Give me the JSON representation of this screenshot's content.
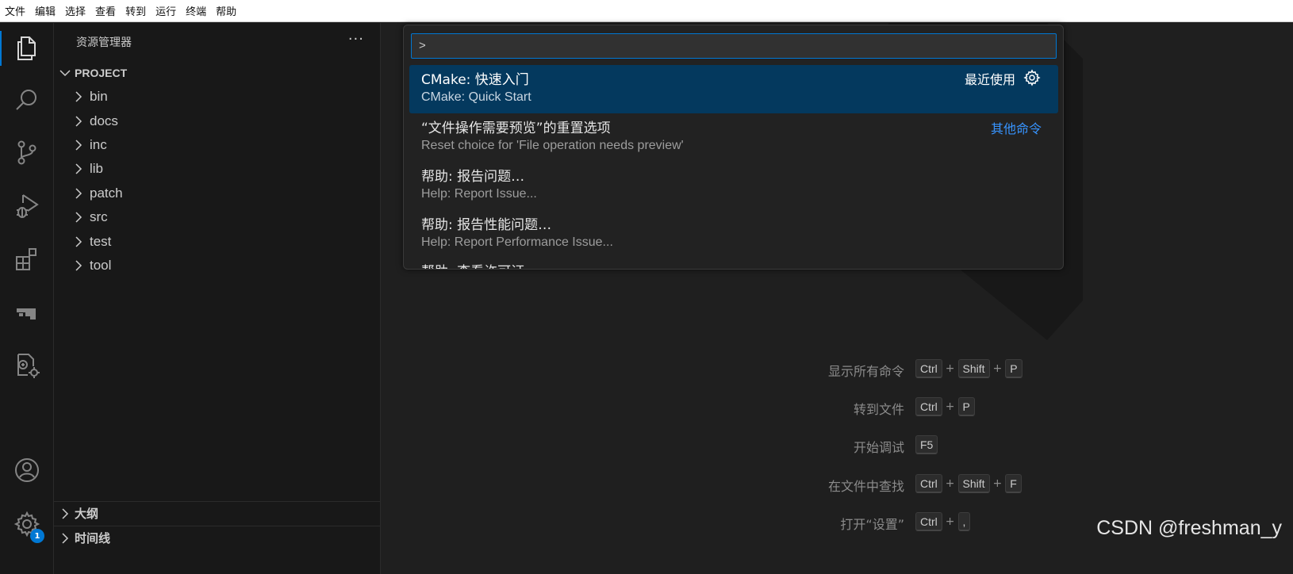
{
  "menubar": {
    "items": [
      "文件",
      "编辑",
      "选择",
      "查看",
      "转到",
      "运行",
      "终端",
      "帮助"
    ]
  },
  "activity_bar": {
    "items": [
      {
        "icon": "files-icon",
        "active": true
      },
      {
        "icon": "search-icon",
        "active": false
      },
      {
        "icon": "source-control-icon",
        "active": false
      },
      {
        "icon": "run-debug-icon",
        "active": false
      },
      {
        "icon": "extensions-icon",
        "active": false
      },
      {
        "icon": "remote-explorer-icon",
        "active": false
      },
      {
        "icon": "cmake-icon",
        "active": false
      }
    ],
    "bottom": [
      {
        "icon": "account-icon"
      },
      {
        "icon": "manage-gear-icon",
        "badge": "1"
      }
    ]
  },
  "sidebar": {
    "title": "资源管理器",
    "more": "···",
    "root": "PROJECT",
    "folders": [
      "bin",
      "docs",
      "inc",
      "lib",
      "patch",
      "src",
      "test",
      "tool"
    ],
    "sections": [
      "大纲",
      "时间线"
    ]
  },
  "command_palette": {
    "input_value": ">",
    "items": [
      {
        "primary": "CMake: 快速入门",
        "secondary": "CMake: Quick Start",
        "tag": "最近使用",
        "selected": true
      },
      {
        "primary": "“文件操作需要预览”的重置选项",
        "secondary": "Reset choice for 'File operation needs preview'",
        "link": "其他命令"
      },
      {
        "primary": "帮助: 报告问题…",
        "secondary": "Help: Report Issue..."
      },
      {
        "primary": "帮助: 报告性能问题…",
        "secondary": "Help: Report Performance Issue..."
      },
      {
        "primary": "帮助: 查看许可证",
        "secondary": ""
      }
    ]
  },
  "shortcuts": [
    {
      "label": "显示所有命令",
      "keys": [
        "Ctrl",
        "Shift",
        "P"
      ]
    },
    {
      "label": "转到文件",
      "keys": [
        "Ctrl",
        "P"
      ]
    },
    {
      "label": "开始调试",
      "keys": [
        "F5"
      ]
    },
    {
      "label": "在文件中查找",
      "keys": [
        "Ctrl",
        "Shift",
        "F"
      ]
    },
    {
      "label": "打开“设置”",
      "keys": [
        "Ctrl",
        ","
      ]
    }
  ],
  "watermark": "CSDN @freshman_y",
  "colors": {
    "accent": "#0078d4",
    "selection": "#04395e",
    "link": "#3794ff",
    "background": "#1f1f1f",
    "sidebar": "#181818"
  }
}
